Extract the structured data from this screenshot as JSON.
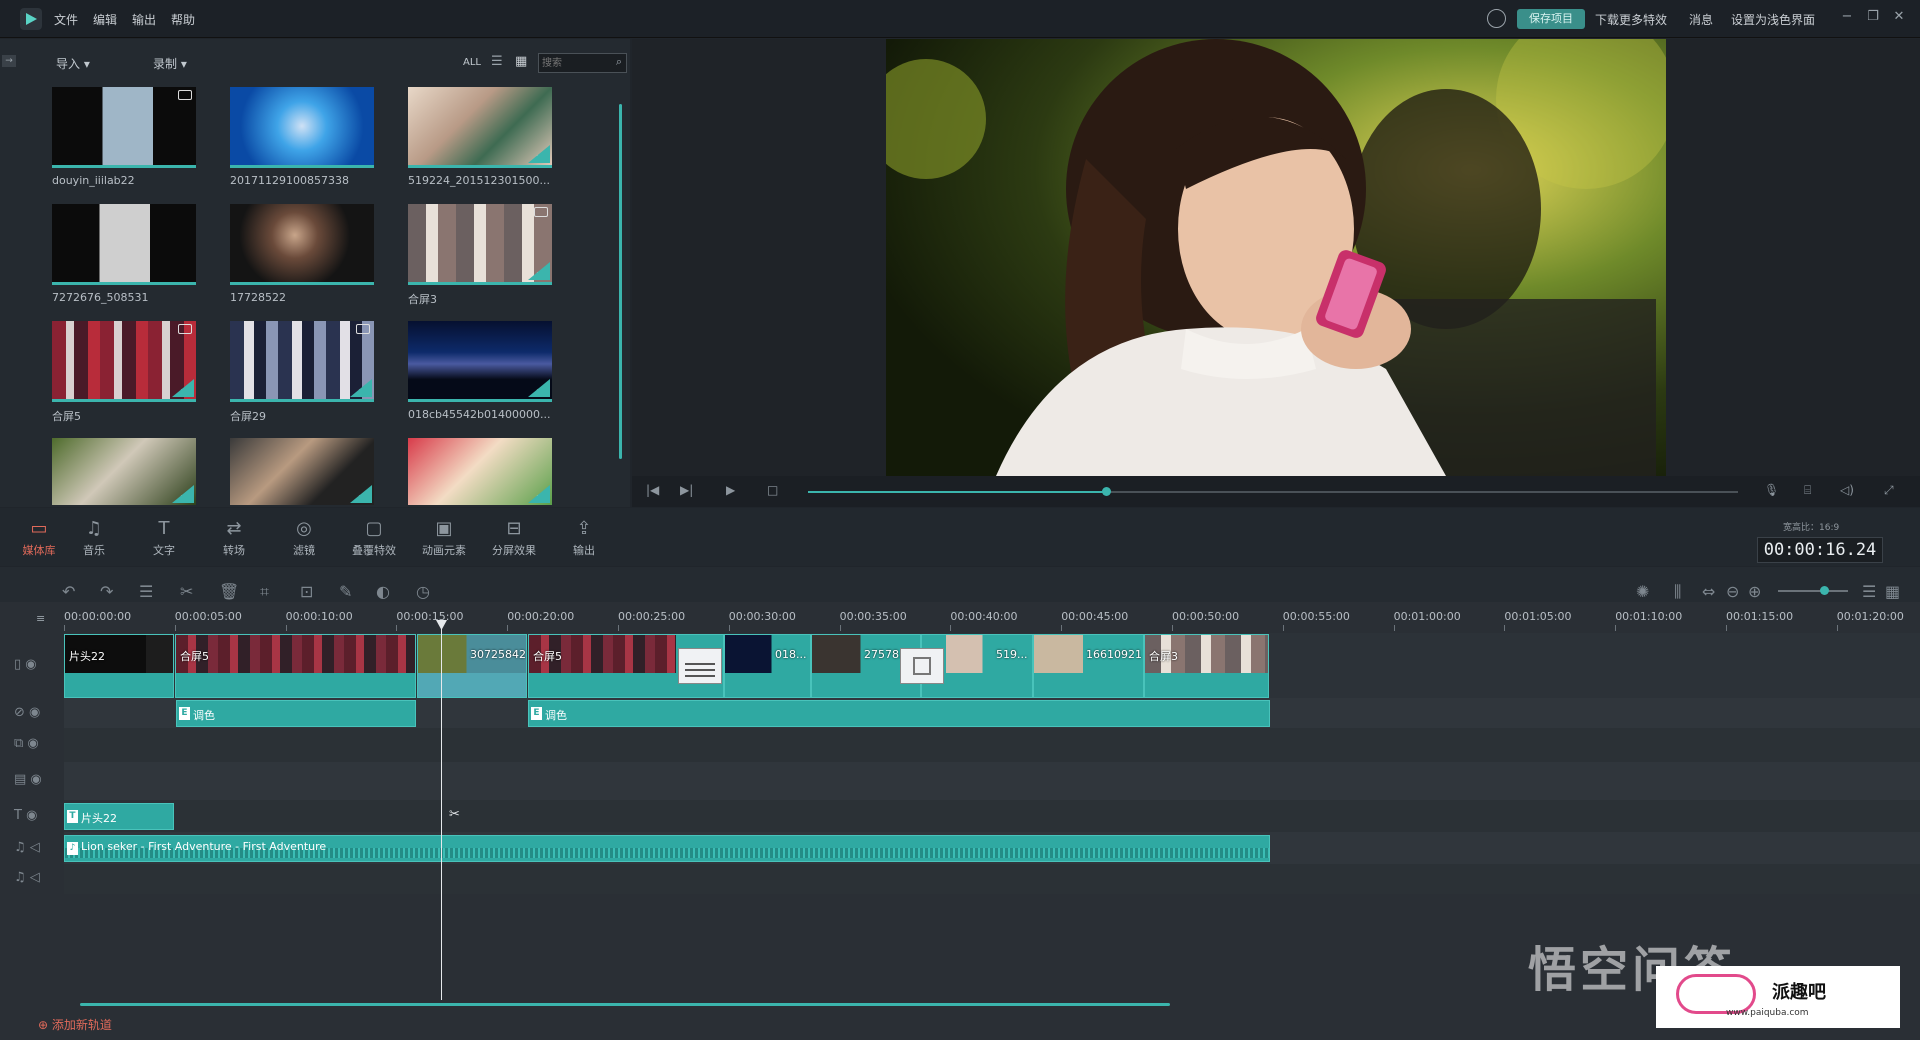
{
  "titlebar": {
    "menus": [
      "文件",
      "编辑",
      "输出",
      "帮助"
    ],
    "save_project": "保存项目",
    "download_effects": "下载更多特效",
    "messages": "消息",
    "theme": "设置为浅色界面"
  },
  "media": {
    "import": "导入",
    "record": "录制",
    "filter_all": "ALL",
    "search_placeholder": "搜索",
    "items": [
      {
        "label": "douyin_iiilab22"
      },
      {
        "label": "20171129100857338"
      },
      {
        "label": "519224_201512301500..."
      },
      {
        "label": "7272676_508531"
      },
      {
        "label": "17728522"
      },
      {
        "label": "合屏3"
      },
      {
        "label": "合屏5"
      },
      {
        "label": "合屏29"
      },
      {
        "label": "018cb45542b01400000..."
      },
      {
        "label": ""
      },
      {
        "label": ""
      },
      {
        "label": ""
      }
    ]
  },
  "tools": [
    {
      "label": "媒体库",
      "icon": "folder-icon"
    },
    {
      "label": "音乐",
      "icon": "music-icon"
    },
    {
      "label": "文字",
      "icon": "text-icon"
    },
    {
      "label": "转场",
      "icon": "transition-icon"
    },
    {
      "label": "滤镜",
      "icon": "filter-icon"
    },
    {
      "label": "叠覆特效",
      "icon": "overlay-icon"
    },
    {
      "label": "动画元素",
      "icon": "elements-icon"
    },
    {
      "label": "分屏效果",
      "icon": "split-screen-icon"
    },
    {
      "label": "输出",
      "icon": "export-icon"
    }
  ],
  "preview": {
    "aspect": "宽高比：16:9",
    "timecode": "00:00:16.24",
    "progress_fraction": 0.32
  },
  "timeline": {
    "ticks": [
      "00:00:00:00",
      "00:00:05:00",
      "00:00:10:00",
      "00:00:15:00",
      "00:00:20:00",
      "00:00:25:00",
      "00:00:30:00",
      "00:00:35:00",
      "00:00:40:00",
      "00:00:45:00",
      "00:00:50:00",
      "00:00:55:00",
      "00:01:00:00",
      "00:01:05:00",
      "00:01:10:00",
      "00:01:15:00",
      "00:01:20:00"
    ],
    "video_clips": [
      "片头22",
      "合屏5",
      "30725842",
      "合屏5",
      "018...",
      "27578...",
      "519...",
      "16610921",
      "合屏3"
    ],
    "color_clips": [
      "调色",
      "调色"
    ],
    "title_clip": "片头22",
    "audio_clip": "Lion seker - First Adventure - First Adventure",
    "add_track": "添加新轨道"
  },
  "watermark": {
    "text1": "悟空问答",
    "text2": "派趣吧",
    "url": "www.paiquba.com"
  },
  "colors": {
    "accent": "#3bb5ad",
    "active_tool": "#e06a5a",
    "clip": "#2fa9a2"
  }
}
